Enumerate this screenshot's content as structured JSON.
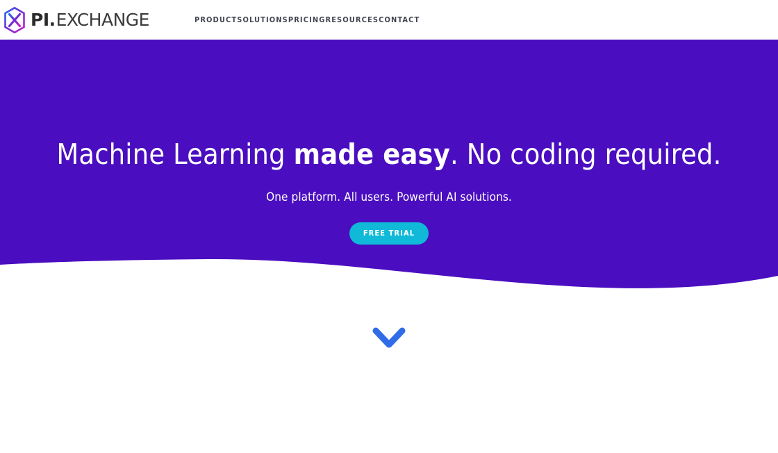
{
  "header": {
    "logo_icon": "hexagon-x-logo-icon",
    "brand_pi": "PI.",
    "brand_exchange": "EXCHANGE",
    "nav": [
      {
        "label": "PRODUCT"
      },
      {
        "label": "SOLUTIONS"
      },
      {
        "label": "PRICING"
      },
      {
        "label": "RESOURCES"
      },
      {
        "label": "CONTACT"
      }
    ]
  },
  "hero": {
    "title_part1": "Machine Learning ",
    "title_strong": "made easy",
    "title_part2": ". No coding required.",
    "subtitle": "One platform. All users. Powerful AI solutions.",
    "cta_label": "FREE TRIAL",
    "scroll_icon": "chevron-down-icon"
  },
  "colors": {
    "hero_purple": "#4a0ec0",
    "cta_cyan": "#0fb9d7",
    "chevron_blue": "#316ce8",
    "nav_text": "#404551",
    "page_background": "#ffffff"
  }
}
